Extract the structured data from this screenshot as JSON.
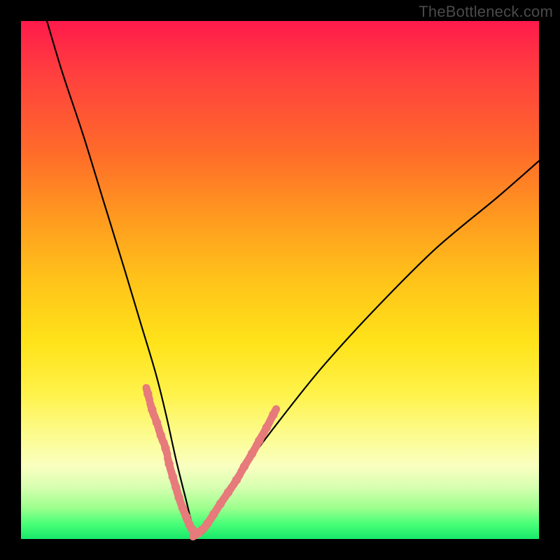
{
  "watermark": "TheBottleneck.com",
  "chart_data": {
    "type": "line",
    "title": "",
    "xlabel": "",
    "ylabel": "",
    "xlim": [
      0,
      100
    ],
    "ylim": [
      0,
      100
    ],
    "grid": false,
    "legend": false,
    "description": "V-shaped bottleneck curve overlaid on a vertical red→green performance gradient. The curve drops steeply from the upper-left, reaches a minimum near x≈34 at the very bottom (green zone), and rises more gently toward the upper-right.",
    "series": [
      {
        "name": "bottleneck-curve",
        "color": "#000000",
        "x": [
          5,
          8,
          12,
          16,
          20,
          23,
          26,
          28,
          30,
          32,
          33,
          34,
          35,
          36,
          38,
          40,
          44,
          50,
          58,
          68,
          80,
          92,
          100
        ],
        "y": [
          100,
          90,
          78,
          65,
          52,
          42,
          32,
          24,
          15,
          7,
          3,
          1,
          1,
          2,
          5,
          9,
          15,
          23,
          33,
          44,
          56,
          66,
          73
        ]
      },
      {
        "name": "highlight-dots-left",
        "color": "#e77a7a",
        "type": "scatter",
        "x": [
          24.5,
          25.3,
          26.2,
          27.0,
          27.9,
          28.6,
          29.3,
          29.9,
          30.5,
          31.2,
          31.9,
          32.5,
          33.1
        ],
        "y": [
          28,
          25,
          22.5,
          20,
          17.5,
          14.5,
          12,
          10,
          8,
          6,
          4.3,
          2.8,
          1.8
        ]
      },
      {
        "name": "highlight-dots-right",
        "color": "#e77a7a",
        "type": "scatter",
        "x": [
          34.2,
          35.0,
          36.0,
          37.2,
          38.5,
          40.0,
          41.6,
          43.1,
          44.6,
          46.0,
          47.4,
          48.7
        ],
        "y": [
          1.2,
          1.8,
          3.0,
          4.8,
          6.8,
          9.0,
          11.4,
          14.0,
          16.5,
          19.0,
          21.5,
          24.0
        ]
      }
    ]
  }
}
